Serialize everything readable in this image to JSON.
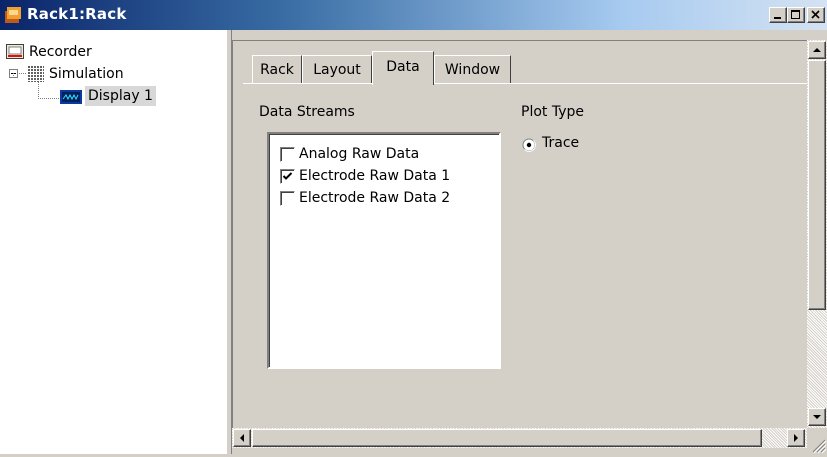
{
  "window": {
    "title": "Rack1:Rack",
    "buttons": [
      "minimize-icon",
      "maximize-icon",
      "close-icon"
    ]
  },
  "tree": {
    "items": [
      {
        "label": "Recorder",
        "icon": "recorder-icon",
        "level": 0
      },
      {
        "label": "Simulation",
        "icon": "simulation-icon",
        "level": 1,
        "expander": "-"
      },
      {
        "label": "Display 1",
        "icon": "display-icon",
        "level": 2,
        "selected": true
      }
    ]
  },
  "tabs": {
    "items": [
      {
        "label": "Rack"
      },
      {
        "label": "Layout"
      },
      {
        "label": "Data",
        "active": true
      },
      {
        "label": "Window"
      }
    ]
  },
  "data_streams": {
    "label": "Data Streams",
    "items": [
      {
        "label": "Analog Raw Data",
        "checked": false
      },
      {
        "label": "Electrode Raw Data 1",
        "checked": true
      },
      {
        "label": "Electrode Raw Data 2",
        "checked": false
      }
    ]
  },
  "plot_type": {
    "label": "Plot Type",
    "options": [
      {
        "label": "Trace",
        "selected": true
      }
    ]
  },
  "colors": {
    "title_start": "#0a246a",
    "title_end": "#a6caf0",
    "face": "#d4d0c8",
    "selection": "#d8d8d8"
  }
}
